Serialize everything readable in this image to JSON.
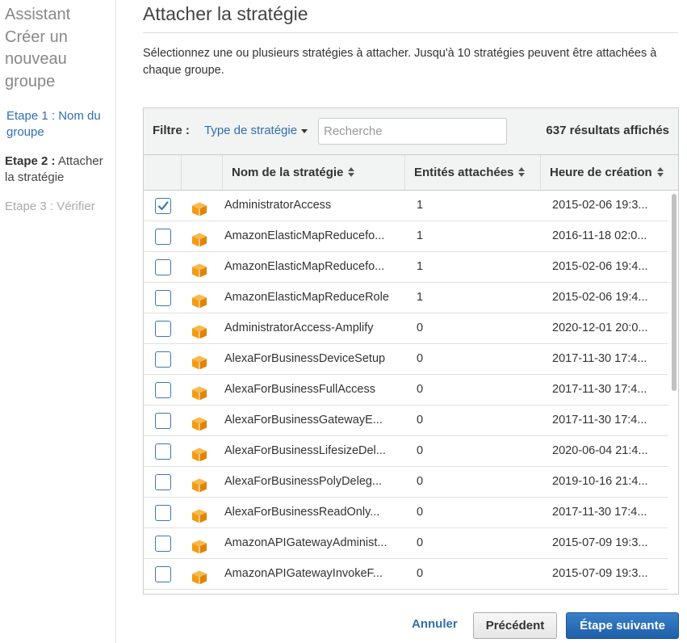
{
  "sidebar": {
    "wizard_title": "Assistant Créer un nouveau groupe",
    "steps": [
      {
        "label": "Etape 1 : Nom du groupe"
      },
      {
        "prefix": "Etape 2 :",
        "label": "Attacher la stratégie"
      },
      {
        "label": "Etape 3 : Vérifier"
      }
    ]
  },
  "main": {
    "title": "Attacher la stratégie",
    "description": "Sélectionnez une ou plusieurs stratégies à attacher. Jusqu'à 10 stratégies peuvent être attachées à chaque groupe."
  },
  "filter": {
    "label": "Filtre :",
    "type_label": "Type de stratégie",
    "search_placeholder": "Recherche",
    "results": "637 résultats affichés"
  },
  "table": {
    "columns": [
      "Nom de la stratégie",
      "Entités attachées",
      "Heure de création"
    ],
    "rows": [
      {
        "checked": true,
        "name": "AdministratorAccess",
        "entities": "1",
        "created": "2015-02-06 19:3..."
      },
      {
        "checked": false,
        "name": "AmazonElasticMapReducefo...",
        "entities": "1",
        "created": "2016-11-18 02:0..."
      },
      {
        "checked": false,
        "name": "AmazonElasticMapReducefo...",
        "entities": "1",
        "created": "2015-02-06 19:4..."
      },
      {
        "checked": false,
        "name": "AmazonElasticMapReduceRole",
        "entities": "1",
        "created": "2015-02-06 19:4..."
      },
      {
        "checked": false,
        "name": "AdministratorAccess-Amplify",
        "entities": "0",
        "created": "2020-12-01 20:0..."
      },
      {
        "checked": false,
        "name": "AlexaForBusinessDeviceSetup",
        "entities": "0",
        "created": "2017-11-30 17:4..."
      },
      {
        "checked": false,
        "name": "AlexaForBusinessFullAccess",
        "entities": "0",
        "created": "2017-11-30 17:4..."
      },
      {
        "checked": false,
        "name": "AlexaForBusinessGatewayE...",
        "entities": "0",
        "created": "2017-11-30 17:4..."
      },
      {
        "checked": false,
        "name": "AlexaForBusinessLifesizeDel...",
        "entities": "0",
        "created": "2020-06-04 21:4..."
      },
      {
        "checked": false,
        "name": "AlexaForBusinessPolyDeleg...",
        "entities": "0",
        "created": "2019-10-16 21:4..."
      },
      {
        "checked": false,
        "name": "AlexaForBusinessReadOnly...",
        "entities": "0",
        "created": "2017-11-30 17:4..."
      },
      {
        "checked": false,
        "name": "AmazonAPIGatewayAdminist...",
        "entities": "0",
        "created": "2015-07-09 19:3..."
      },
      {
        "checked": false,
        "name": "AmazonAPIGatewayInvokeF...",
        "entities": "0",
        "created": "2015-07-09 19:3..."
      }
    ]
  },
  "footer": {
    "cancel": "Annuler",
    "previous": "Précédent",
    "next": "Étape suivante"
  },
  "colors": {
    "link": "#2f6fb1",
    "primary_button": "#2a70b8",
    "policy_icon": "#f29c12"
  },
  "icons": {
    "policy": "aws-box-icon",
    "checkbox": "checkmark-icon",
    "dropdown": "caret-down-icon",
    "sort": "sort-icon"
  }
}
